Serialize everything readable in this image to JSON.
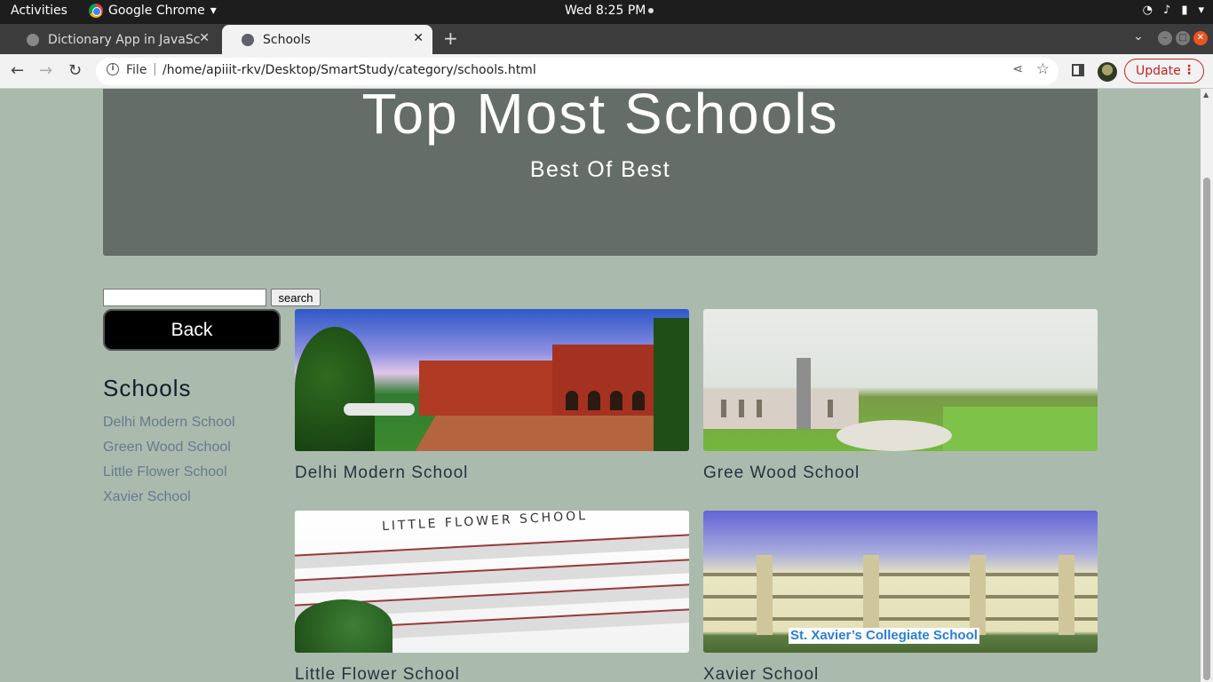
{
  "os": {
    "activities": "Activities",
    "app_name": "Google Chrome",
    "clock": "Wed  8:25 PM"
  },
  "browser": {
    "tabs": [
      {
        "title": "Dictionary App in JavaScr",
        "active": false
      },
      {
        "title": "Schools",
        "active": true
      }
    ],
    "address": {
      "scheme_label": "File",
      "url": "/home/apiiit-rkv/Desktop/SmartStudy/category/schools.html"
    },
    "update_label": "Update"
  },
  "page": {
    "hero": {
      "title": "Top Most Schools",
      "subtitle": "Best Of Best"
    },
    "search": {
      "value": "",
      "button_label": "search"
    },
    "back_label": "Back",
    "sidebar": {
      "heading": "Schools",
      "links": [
        "Delhi Modern School",
        "Green Wood School",
        "Little Flower School",
        "Xavier School"
      ]
    },
    "cards": [
      {
        "caption": "Delhi Modern School"
      },
      {
        "caption": "Gree Wood School"
      },
      {
        "caption": "Little Flower School",
        "image_text": "LITTLE FLOWER SCHOOL"
      },
      {
        "caption": "Xavier School",
        "image_text": "St. Xavier’s Collegiate School"
      }
    ]
  }
}
